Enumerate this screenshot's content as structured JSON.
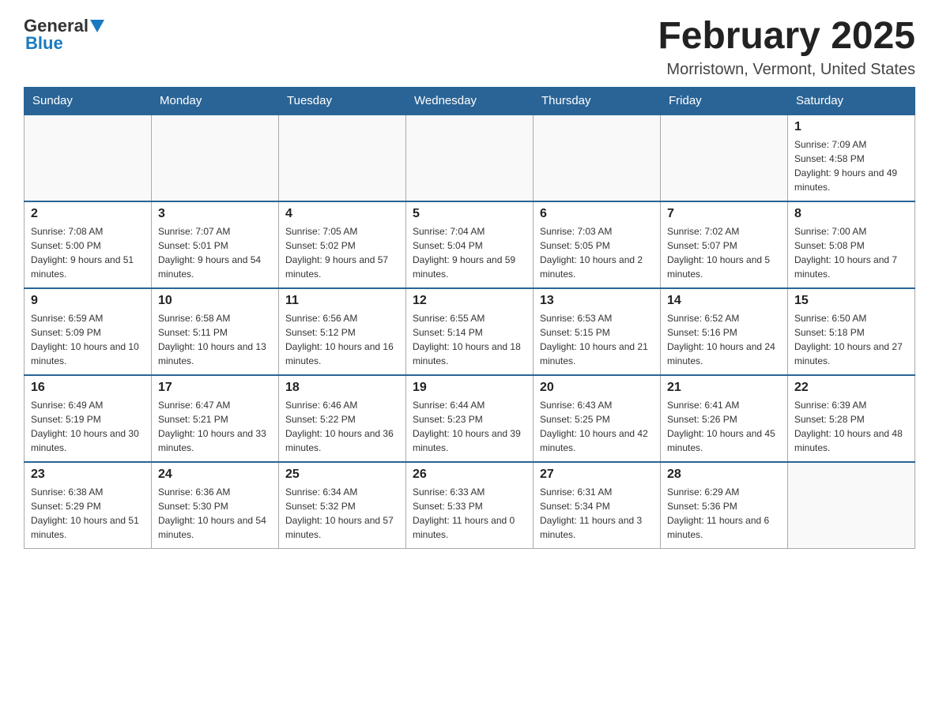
{
  "header": {
    "logo": {
      "general": "General",
      "blue": "Blue"
    },
    "title": "February 2025",
    "location": "Morristown, Vermont, United States"
  },
  "weekdays": [
    "Sunday",
    "Monday",
    "Tuesday",
    "Wednesday",
    "Thursday",
    "Friday",
    "Saturday"
  ],
  "weeks": [
    [
      {
        "day": "",
        "info": ""
      },
      {
        "day": "",
        "info": ""
      },
      {
        "day": "",
        "info": ""
      },
      {
        "day": "",
        "info": ""
      },
      {
        "day": "",
        "info": ""
      },
      {
        "day": "",
        "info": ""
      },
      {
        "day": "1",
        "info": "Sunrise: 7:09 AM\nSunset: 4:58 PM\nDaylight: 9 hours and 49 minutes."
      }
    ],
    [
      {
        "day": "2",
        "info": "Sunrise: 7:08 AM\nSunset: 5:00 PM\nDaylight: 9 hours and 51 minutes."
      },
      {
        "day": "3",
        "info": "Sunrise: 7:07 AM\nSunset: 5:01 PM\nDaylight: 9 hours and 54 minutes."
      },
      {
        "day": "4",
        "info": "Sunrise: 7:05 AM\nSunset: 5:02 PM\nDaylight: 9 hours and 57 minutes."
      },
      {
        "day": "5",
        "info": "Sunrise: 7:04 AM\nSunset: 5:04 PM\nDaylight: 9 hours and 59 minutes."
      },
      {
        "day": "6",
        "info": "Sunrise: 7:03 AM\nSunset: 5:05 PM\nDaylight: 10 hours and 2 minutes."
      },
      {
        "day": "7",
        "info": "Sunrise: 7:02 AM\nSunset: 5:07 PM\nDaylight: 10 hours and 5 minutes."
      },
      {
        "day": "8",
        "info": "Sunrise: 7:00 AM\nSunset: 5:08 PM\nDaylight: 10 hours and 7 minutes."
      }
    ],
    [
      {
        "day": "9",
        "info": "Sunrise: 6:59 AM\nSunset: 5:09 PM\nDaylight: 10 hours and 10 minutes."
      },
      {
        "day": "10",
        "info": "Sunrise: 6:58 AM\nSunset: 5:11 PM\nDaylight: 10 hours and 13 minutes."
      },
      {
        "day": "11",
        "info": "Sunrise: 6:56 AM\nSunset: 5:12 PM\nDaylight: 10 hours and 16 minutes."
      },
      {
        "day": "12",
        "info": "Sunrise: 6:55 AM\nSunset: 5:14 PM\nDaylight: 10 hours and 18 minutes."
      },
      {
        "day": "13",
        "info": "Sunrise: 6:53 AM\nSunset: 5:15 PM\nDaylight: 10 hours and 21 minutes."
      },
      {
        "day": "14",
        "info": "Sunrise: 6:52 AM\nSunset: 5:16 PM\nDaylight: 10 hours and 24 minutes."
      },
      {
        "day": "15",
        "info": "Sunrise: 6:50 AM\nSunset: 5:18 PM\nDaylight: 10 hours and 27 minutes."
      }
    ],
    [
      {
        "day": "16",
        "info": "Sunrise: 6:49 AM\nSunset: 5:19 PM\nDaylight: 10 hours and 30 minutes."
      },
      {
        "day": "17",
        "info": "Sunrise: 6:47 AM\nSunset: 5:21 PM\nDaylight: 10 hours and 33 minutes."
      },
      {
        "day": "18",
        "info": "Sunrise: 6:46 AM\nSunset: 5:22 PM\nDaylight: 10 hours and 36 minutes."
      },
      {
        "day": "19",
        "info": "Sunrise: 6:44 AM\nSunset: 5:23 PM\nDaylight: 10 hours and 39 minutes."
      },
      {
        "day": "20",
        "info": "Sunrise: 6:43 AM\nSunset: 5:25 PM\nDaylight: 10 hours and 42 minutes."
      },
      {
        "day": "21",
        "info": "Sunrise: 6:41 AM\nSunset: 5:26 PM\nDaylight: 10 hours and 45 minutes."
      },
      {
        "day": "22",
        "info": "Sunrise: 6:39 AM\nSunset: 5:28 PM\nDaylight: 10 hours and 48 minutes."
      }
    ],
    [
      {
        "day": "23",
        "info": "Sunrise: 6:38 AM\nSunset: 5:29 PM\nDaylight: 10 hours and 51 minutes."
      },
      {
        "day": "24",
        "info": "Sunrise: 6:36 AM\nSunset: 5:30 PM\nDaylight: 10 hours and 54 minutes."
      },
      {
        "day": "25",
        "info": "Sunrise: 6:34 AM\nSunset: 5:32 PM\nDaylight: 10 hours and 57 minutes."
      },
      {
        "day": "26",
        "info": "Sunrise: 6:33 AM\nSunset: 5:33 PM\nDaylight: 11 hours and 0 minutes."
      },
      {
        "day": "27",
        "info": "Sunrise: 6:31 AM\nSunset: 5:34 PM\nDaylight: 11 hours and 3 minutes."
      },
      {
        "day": "28",
        "info": "Sunrise: 6:29 AM\nSunset: 5:36 PM\nDaylight: 11 hours and 6 minutes."
      },
      {
        "day": "",
        "info": ""
      }
    ]
  ]
}
